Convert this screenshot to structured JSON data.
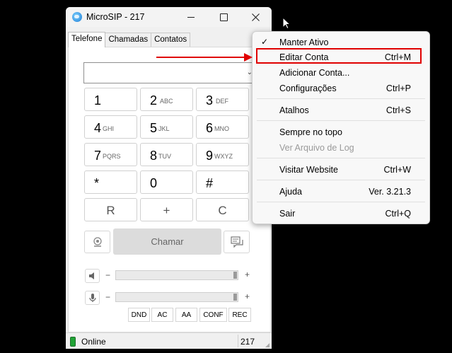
{
  "window": {
    "title": "MicroSIP - 217",
    "tabs": [
      "Telefone",
      "Chamadas",
      "Contatos"
    ],
    "keypad": [
      {
        "digit": "1",
        "letters": ""
      },
      {
        "digit": "2",
        "letters": "ABC"
      },
      {
        "digit": "3",
        "letters": "DEF"
      },
      {
        "digit": "4",
        "letters": "GHI"
      },
      {
        "digit": "5",
        "letters": "JKL"
      },
      {
        "digit": "6",
        "letters": "MNO"
      },
      {
        "digit": "7",
        "letters": "PQRS"
      },
      {
        "digit": "8",
        "letters": "TUV"
      },
      {
        "digit": "9",
        "letters": "WXYZ"
      },
      {
        "digit": "*",
        "letters": ""
      },
      {
        "digit": "0",
        "letters": ""
      },
      {
        "digit": "#",
        "letters": ""
      }
    ],
    "controls": {
      "redial": "R",
      "plus": "+",
      "clear": "C"
    },
    "call_label": "Chamar",
    "minus": "−",
    "plus": "+",
    "small_buttons": [
      "DND",
      "AC",
      "AA",
      "CONF",
      "REC"
    ],
    "status": {
      "text": "Online",
      "extension": "217"
    }
  },
  "menu": {
    "items": [
      {
        "label": "Manter Ativo",
        "shortcut": "",
        "checked": "✓"
      },
      {
        "label": "Editar Conta",
        "shortcut": "Ctrl+M"
      },
      {
        "label": "Adicionar Conta...",
        "shortcut": ""
      },
      {
        "label": "Configurações",
        "shortcut": "Ctrl+P"
      },
      {
        "label": "Atalhos",
        "shortcut": "Ctrl+S"
      },
      {
        "label": "Sempre no topo",
        "shortcut": ""
      },
      {
        "label": "Ver Arquivo de Log",
        "shortcut": ""
      },
      {
        "label": "Visitar Website",
        "shortcut": "Ctrl+W"
      },
      {
        "label": "Ajuda",
        "shortcut": "Ver. 3.21.3"
      },
      {
        "label": "Sair",
        "shortcut": "Ctrl+Q"
      }
    ]
  },
  "colors": {
    "highlight": "#e00000",
    "online": "#21a336"
  }
}
